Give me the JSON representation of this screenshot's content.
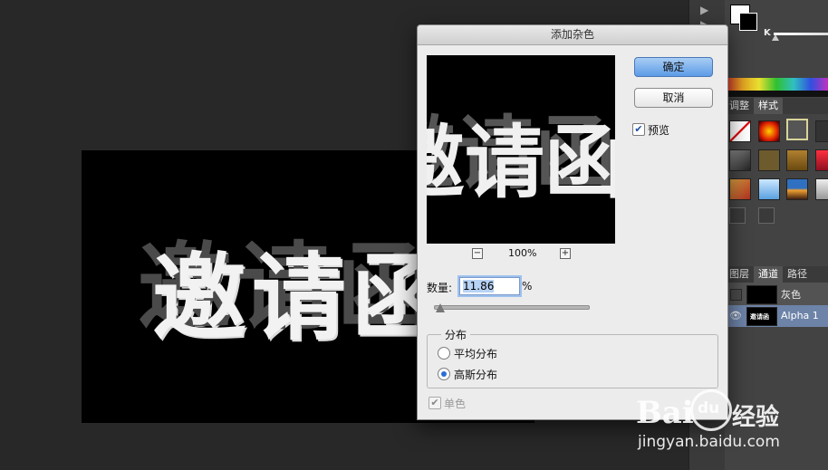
{
  "dialog": {
    "title": "添加杂色",
    "ok_label": "确定",
    "cancel_label": "取消",
    "preview_label": "预览",
    "preview_checked": true,
    "preview_text": "邀请函",
    "zoom_minus": "−",
    "zoom_plus": "+",
    "zoom_level": "100%",
    "amount_label": "数量:",
    "amount_value": "11.86",
    "amount_unit": "%",
    "amount_slider_fraction": 0.02,
    "distribution_group_label": "分布",
    "distribution_options": [
      "平均分布",
      "高斯分布"
    ],
    "distribution_selected": "高斯分布",
    "monochrome_label": "单色",
    "monochrome_checked": true
  },
  "canvas": {
    "text": "邀请函"
  },
  "panel": {
    "color_k_label": "K",
    "style_tabs": [
      "调整",
      "样式"
    ],
    "style_active_tab": "样式",
    "channel_tabs": [
      "图层",
      "通道",
      "路径"
    ],
    "channel_active_tab": "通道",
    "channels": [
      {
        "name": "灰色",
        "visible": false
      },
      {
        "name": "Alpha 1",
        "visible": true,
        "thumb_text": "邀请函"
      }
    ]
  },
  "watermark": {
    "brand": "Bai",
    "brand2": "du",
    "suffix": "经验",
    "url": "jingyan.baidu.com"
  },
  "colors": {
    "workspace": "#282828",
    "panel": "#434343",
    "dialog_bg": "#ececec",
    "primary_button": "#5c9be6"
  }
}
